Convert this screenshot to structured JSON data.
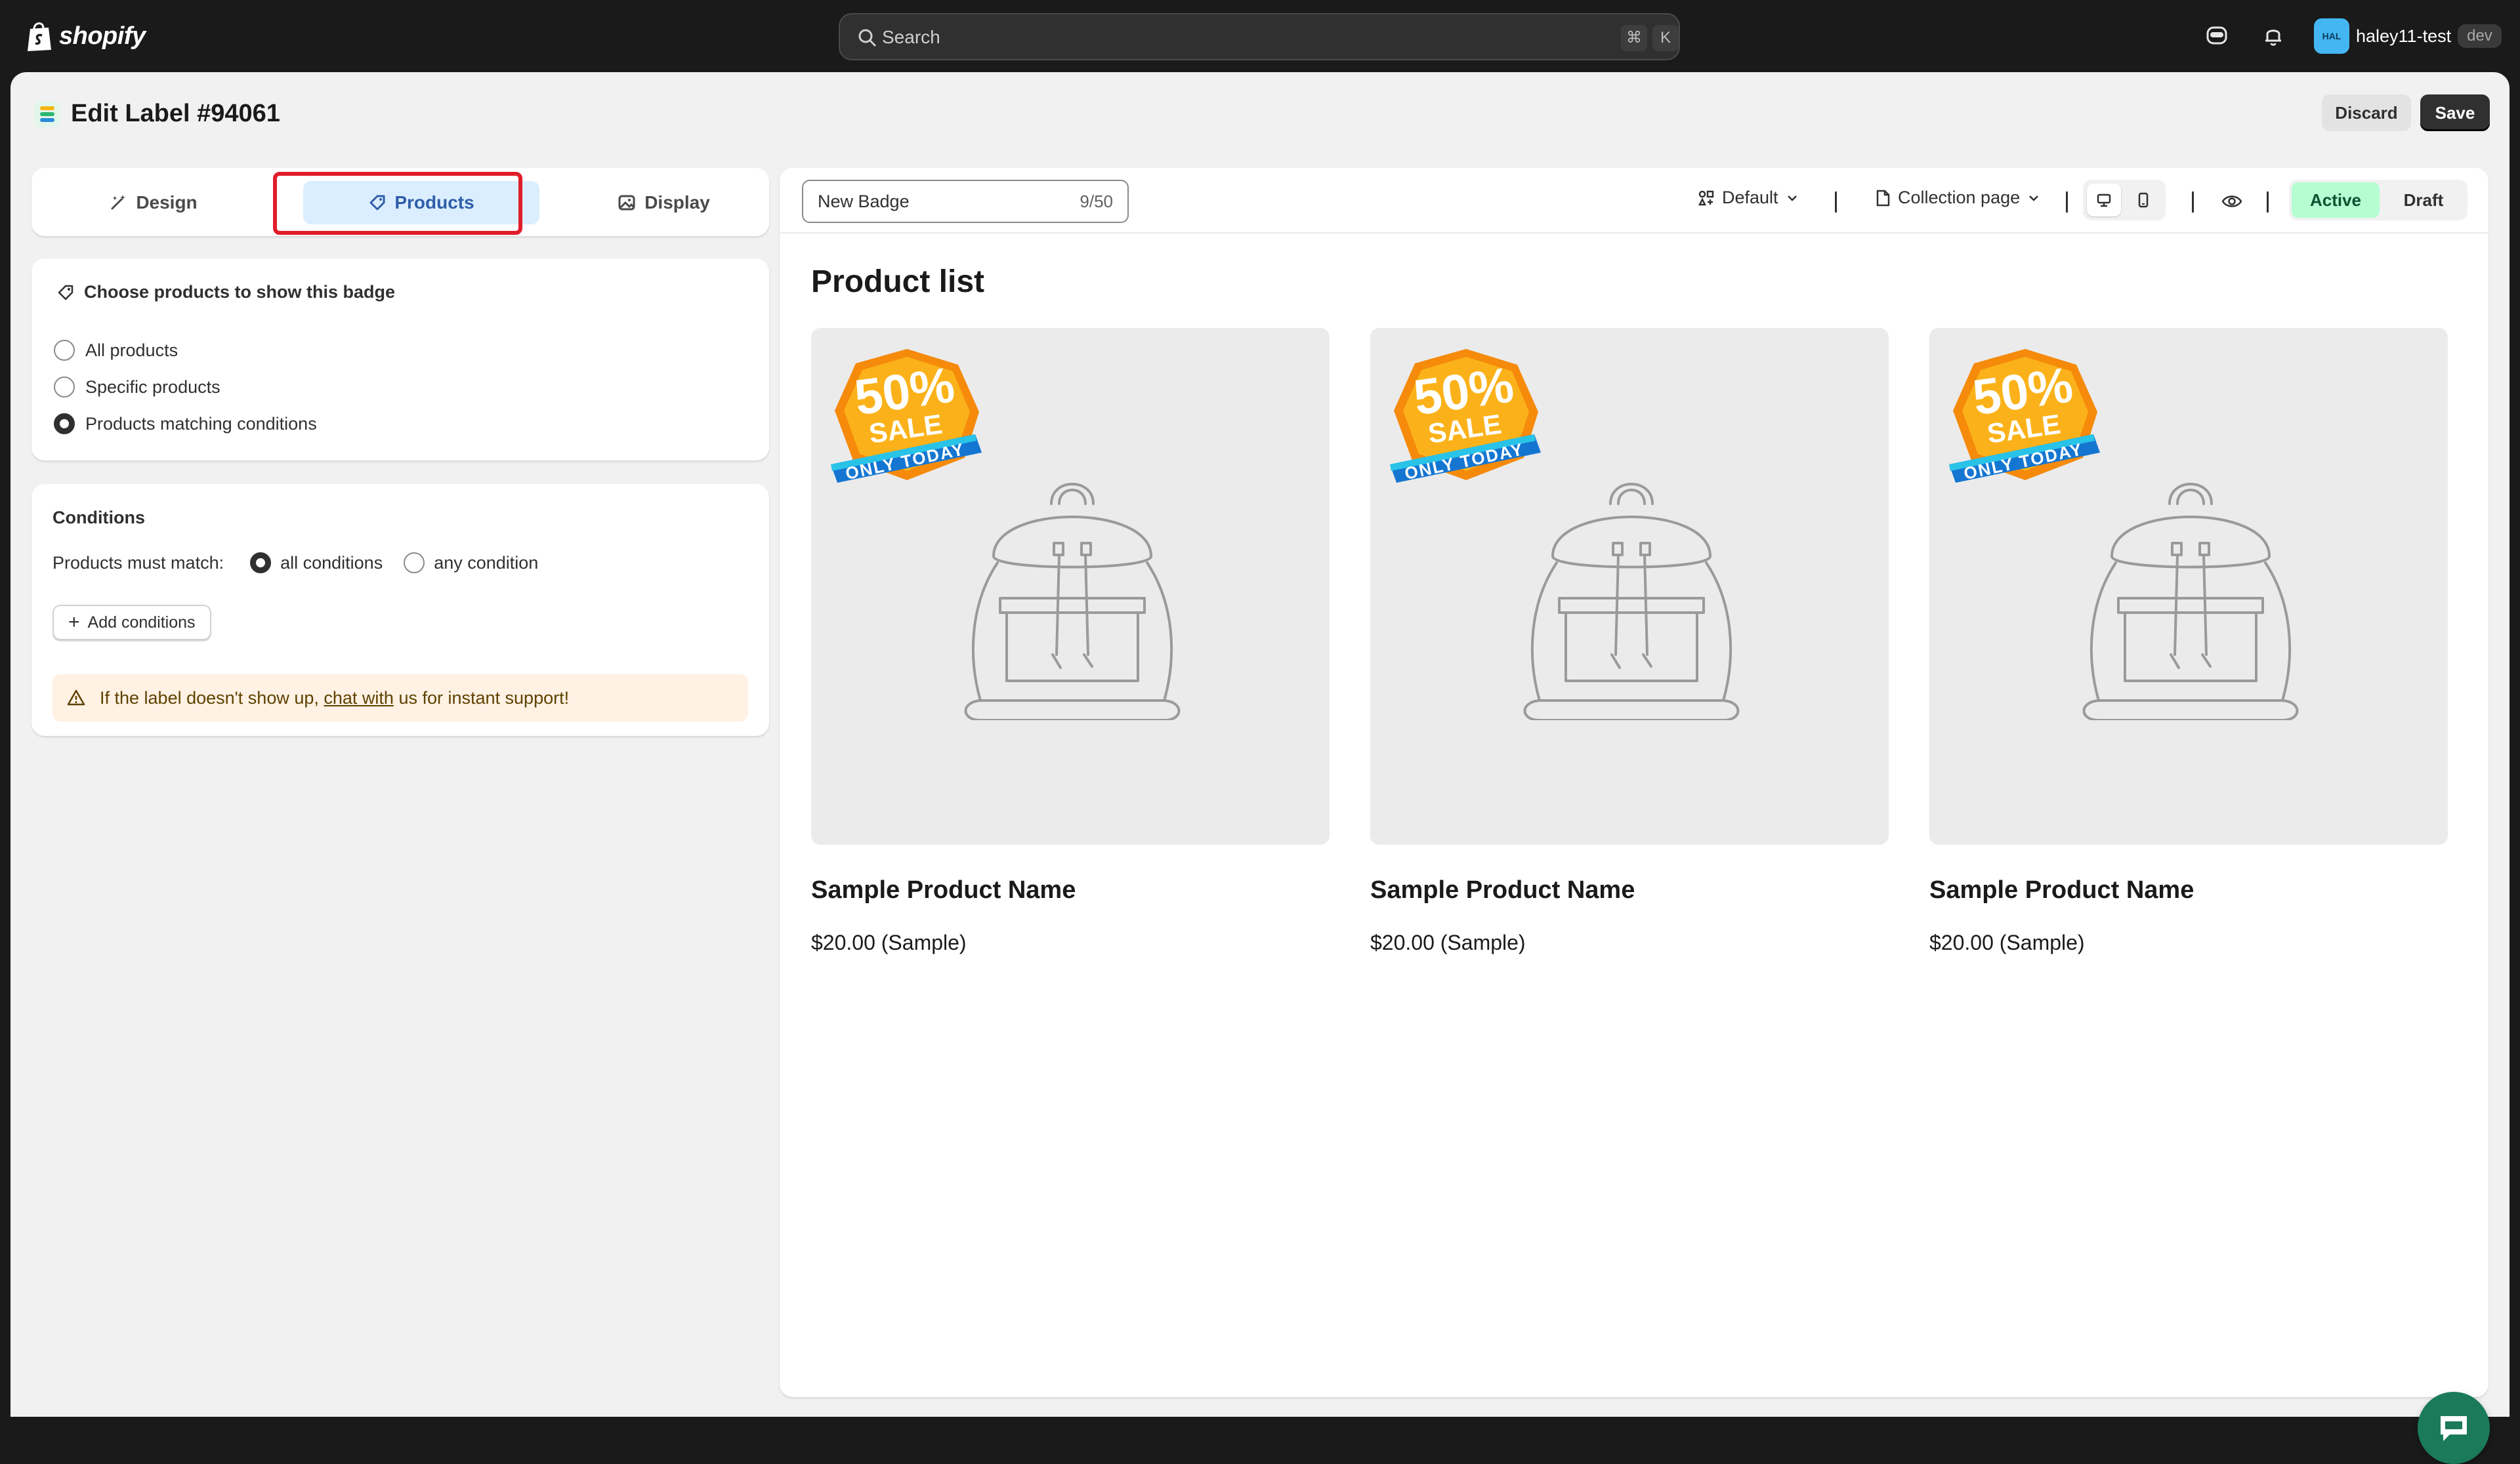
{
  "topbar": {
    "brand": "shopify",
    "search_placeholder": "Search",
    "kbd_cmd": "⌘",
    "kbd_k": "K",
    "user": {
      "avatar_initials": "HAL",
      "name": "haley11-test",
      "badge": "dev"
    }
  },
  "page": {
    "title": "Edit Label #94061",
    "discard_label": "Discard",
    "save_label": "Save"
  },
  "tabs": [
    {
      "label": "Design",
      "icon": "magic-wand-icon",
      "selected": false
    },
    {
      "label": "Products",
      "icon": "tag-icon",
      "selected": true
    },
    {
      "label": "Display",
      "icon": "image-icon",
      "selected": false
    }
  ],
  "products_section": {
    "heading": "Choose products to show this badge",
    "options": [
      {
        "label": "All products",
        "selected": false
      },
      {
        "label": "Specific products",
        "selected": false
      },
      {
        "label": "Products matching conditions",
        "selected": true
      }
    ]
  },
  "conditions": {
    "heading": "Conditions",
    "match_label": "Products must match:",
    "match_options": [
      {
        "label": "all conditions",
        "selected": true
      },
      {
        "label": "any condition",
        "selected": false
      }
    ],
    "add_button": "Add conditions",
    "warning_prefix": "If the label doesn't show up, ",
    "warning_link": "chat with",
    "warning_suffix": " us for instant support!"
  },
  "preview": {
    "badge_name": "New Badge",
    "char_count": "9/50",
    "style_select": "Default",
    "page_select": "Collection page",
    "status": {
      "active": "Active",
      "draft": "Draft",
      "current": "Active"
    },
    "section_title": "Product list",
    "badge_art": {
      "percent": "50%",
      "word": "SALE",
      "ribbon": "ONLY TODAY"
    },
    "products": [
      {
        "name": "Sample Product Name",
        "price": "$20.00 (Sample)"
      },
      {
        "name": "Sample Product Name",
        "price": "$20.00 (Sample)"
      },
      {
        "name": "Sample Product Name",
        "price": "$20.00 (Sample)"
      }
    ]
  },
  "colors": {
    "accent_selected_tab": "#dbeeff",
    "active_status": "#b4fed2",
    "warning_bg": "#fff1e3",
    "highlight_box": "#e11d2a",
    "chat_button": "#1a7a5a"
  }
}
